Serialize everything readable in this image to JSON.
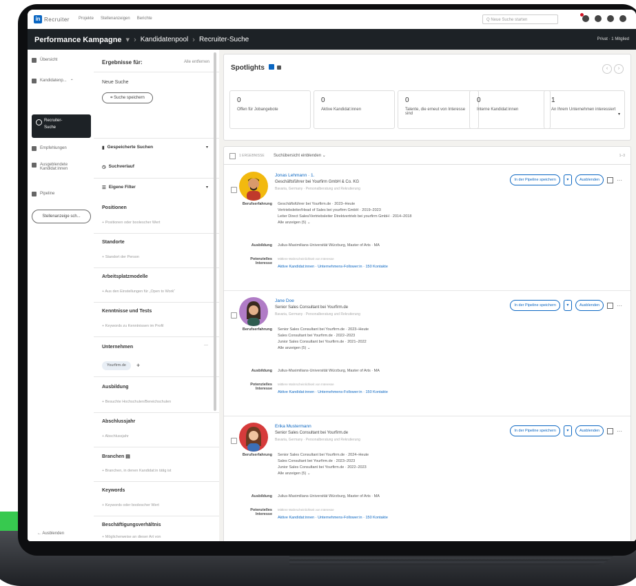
{
  "topbar": {
    "logo_badge": "in",
    "logo_text": "Recruiter",
    "nav": [
      "Projekte",
      "Stellenanzeigen",
      "Berichte"
    ],
    "search_placeholder": "Q Neue Suche starten"
  },
  "breadcrumb": {
    "project": "Performance Kampagne",
    "pool": "Kandidatenpool",
    "page": "Recruiter-Suche",
    "right": "Privat · 1 Mitglied"
  },
  "sidebar": {
    "overview": "Übersicht",
    "candidates": "Kandidatenp...",
    "active_line1": "Recruiter-",
    "active_line2": "Suche",
    "recommendations": "Empfehlungen",
    "applicants_line1": "Ausgeblendete",
    "applicants_line2": "Kandidat:innen",
    "pipeline": "Pipeline",
    "post_job": "Stellenanzeige sch...",
    "hide": "Ausblenden"
  },
  "filters": {
    "header": "Ergebnisse für:",
    "remove_all": "Alle entfernen",
    "new_search": "Neue Suche",
    "save_search": "Suche speichern",
    "saved_searches": "Gespeicherte Suchen",
    "history": "Suchverlauf",
    "custom_filters": "Eigene Filter",
    "sections": [
      {
        "title": "Positionen",
        "hint": "+ Positionen oder boolescher Wert"
      },
      {
        "title": "Standorte",
        "hint": "+ Standort der Person"
      },
      {
        "title": "Arbeitsplatzmodelle",
        "hint": "+ Aus den Einstellungen für „Open to Work“"
      },
      {
        "title": "Kenntnisse und Tests",
        "hint": "+ Keywords zu Kenntnissen im Profil"
      },
      {
        "title": "Unternehmen",
        "chip": "Yourfirm.de"
      },
      {
        "title": "Ausbildung",
        "hint": "+ Besuchte Hochschulen/Bereichschulen"
      },
      {
        "title": "Abschlussjahr",
        "hint": "+ Abschlussjahr"
      },
      {
        "title": "Branchen",
        "hint": "+ Branchen, in denen Kandidat:in tätig ist"
      },
      {
        "title": "Keywords",
        "hint": "+ Keywords oder boolescher Wert"
      },
      {
        "title": "Beschäftigungsverhältnis",
        "hint": "+ Möglicherweise an dieser Art von"
      }
    ]
  },
  "spotlights": {
    "title": "Spotlights",
    "cards": [
      {
        "num": "0",
        "label": "Offen für Jobangebote"
      },
      {
        "num": "0",
        "label": "Aktive Kandidat:innen"
      },
      {
        "num": "0",
        "label": "Talente, die erneut von Interesse sind"
      },
      {
        "num": "0",
        "label": "Interne Kandidat:innen"
      },
      {
        "num": "1",
        "label": "An Ihrem Unternehmen interessiert"
      }
    ]
  },
  "results_bar": {
    "selected": "1 ERGEBNISSE",
    "toggle": "Suchübersicht einblenden",
    "range": "1–3"
  },
  "labels": {
    "experience": "Berufserfahrung",
    "education": "Ausbildung",
    "interests": "Potenzielles Interesse",
    "save_pipeline": "In der Pipeline speichern",
    "hide": "Ausblenden",
    "show_all": "Alle anzeigen (5)"
  },
  "candidates": [
    {
      "name": "Jonas Lehmann · 1.",
      "headline": "Geschäftsführer bei Yourfirm GmbH & Co. KG",
      "location": "Bavaria, Germany · Personalberatung und Rekrutierung",
      "experience": [
        "Geschäftsführer bei Yourfirm.de · 2023–Heute",
        "Vertriebsleiter/Head of Sales bei yourfirm GmbH · 2019–2023",
        "Leiter Direct Sales/Vertriebsleiter Direktvertrieb bei yourfirm GmbH · 2014–2018"
      ],
      "education": "Julius-Maximilians-Universität Würzburg, Master of Arts · MA",
      "interest_hint": "Mittlere Wahrscheinlichkeit von Interesse",
      "interest_links": "Aktive Kandidat:innen · Unternehmens-Follower:in · 150 Kontakte"
    },
    {
      "name": "Jane Doe",
      "headline": "Senior Sales Consultant bei Yourfirm.de",
      "location": "Bavaria, Germany · Personalberatung und Rekrutierung",
      "experience": [
        "Senior Sales Consultant bei Yourfirm.de · 2023–Heute",
        "Sales Consultant bei Yourfirm.de · 2022–2023",
        "Junior Sales Consultant bei Yourfirm.de · 2021–2022"
      ],
      "education": "Julius-Maximilians-Universität Würzburg, Master of Arts · MA",
      "interest_hint": "Mittlere Wahrscheinlichkeit von Interesse",
      "interest_links": "Aktive Kandidat:innen · Unternehmens-Follower:in · 150 Kontakte"
    },
    {
      "name": "Erika Mustermann",
      "headline": "Senior Sales Consultant bei Yourfirm.de",
      "location": "Bavaria, Germany · Personalberatung und Rekrutierung",
      "experience": [
        "Senior Sales Consultant bei Yourfirm.de · 2024–Heute",
        "Sales Consultant bei Yourfirm.de · 2023–2023",
        "Junior Sales Consultant bei Yourfirm.de · 2022–2023"
      ],
      "education": "Julius-Maximilians-Universität Würzburg, Master of Arts · MA",
      "interest_hint": "Mittlere Wahrscheinlichkeit von Interesse",
      "interest_links": "Aktive Kandidat:innen · Unternehmens-Follower:in · 150 Kontakte"
    }
  ],
  "colors": {
    "brand_blue": "#0a66c2",
    "dark_bar": "#1d2226",
    "green_accent": "#37c94f"
  }
}
